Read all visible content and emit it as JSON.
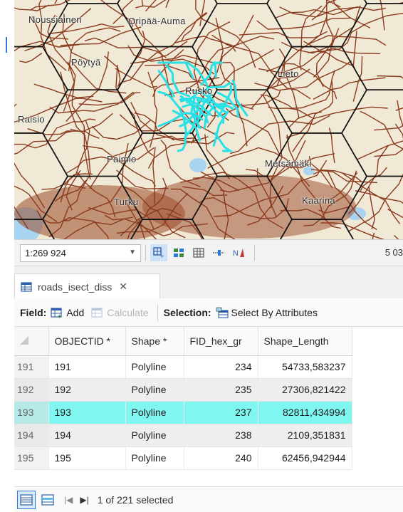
{
  "map": {
    "labels": [
      "Noussiainen",
      "Oripää-Auma",
      "Raisio",
      "Pöytyä",
      "Rusko",
      "Lieto",
      "Paimio",
      "Metsämäki",
      "Turku",
      "Kaarina"
    ]
  },
  "scalebar": {
    "scale": "1:269 924",
    "coords": "5 03"
  },
  "tab": {
    "title": "roads_isect_diss"
  },
  "toolbar": {
    "field_label": "Field:",
    "add_label": "Add",
    "calculate_label": "Calculate",
    "selection_label": "Selection:",
    "select_by_attr_label": "Select By Attributes"
  },
  "table": {
    "columns": [
      "OBJECTID *",
      "Shape *",
      "FID_hex_gr",
      "Shape_Length"
    ],
    "rows": [
      {
        "rownum": "191",
        "objectid": "191",
        "shape": "Polyline",
        "fid": "234",
        "length": "54733,583237"
      },
      {
        "rownum": "192",
        "objectid": "192",
        "shape": "Polyline",
        "fid": "235",
        "length": "27306,821422"
      },
      {
        "rownum": "193",
        "objectid": "193",
        "shape": "Polyline",
        "fid": "237",
        "length": "82811,434994"
      },
      {
        "rownum": "194",
        "objectid": "194",
        "shape": "Polyline",
        "fid": "238",
        "length": "2109,351831"
      },
      {
        "rownum": "195",
        "objectid": "195",
        "shape": "Polyline",
        "fid": "240",
        "length": "62456,942944"
      }
    ]
  },
  "status": {
    "selection_text": "1 of 221 selected"
  },
  "colors": {
    "road": "#8b3a1e",
    "selected_road": "#28e0e6",
    "selected_row": "#80f6f1",
    "water": "#a8d4f2"
  }
}
